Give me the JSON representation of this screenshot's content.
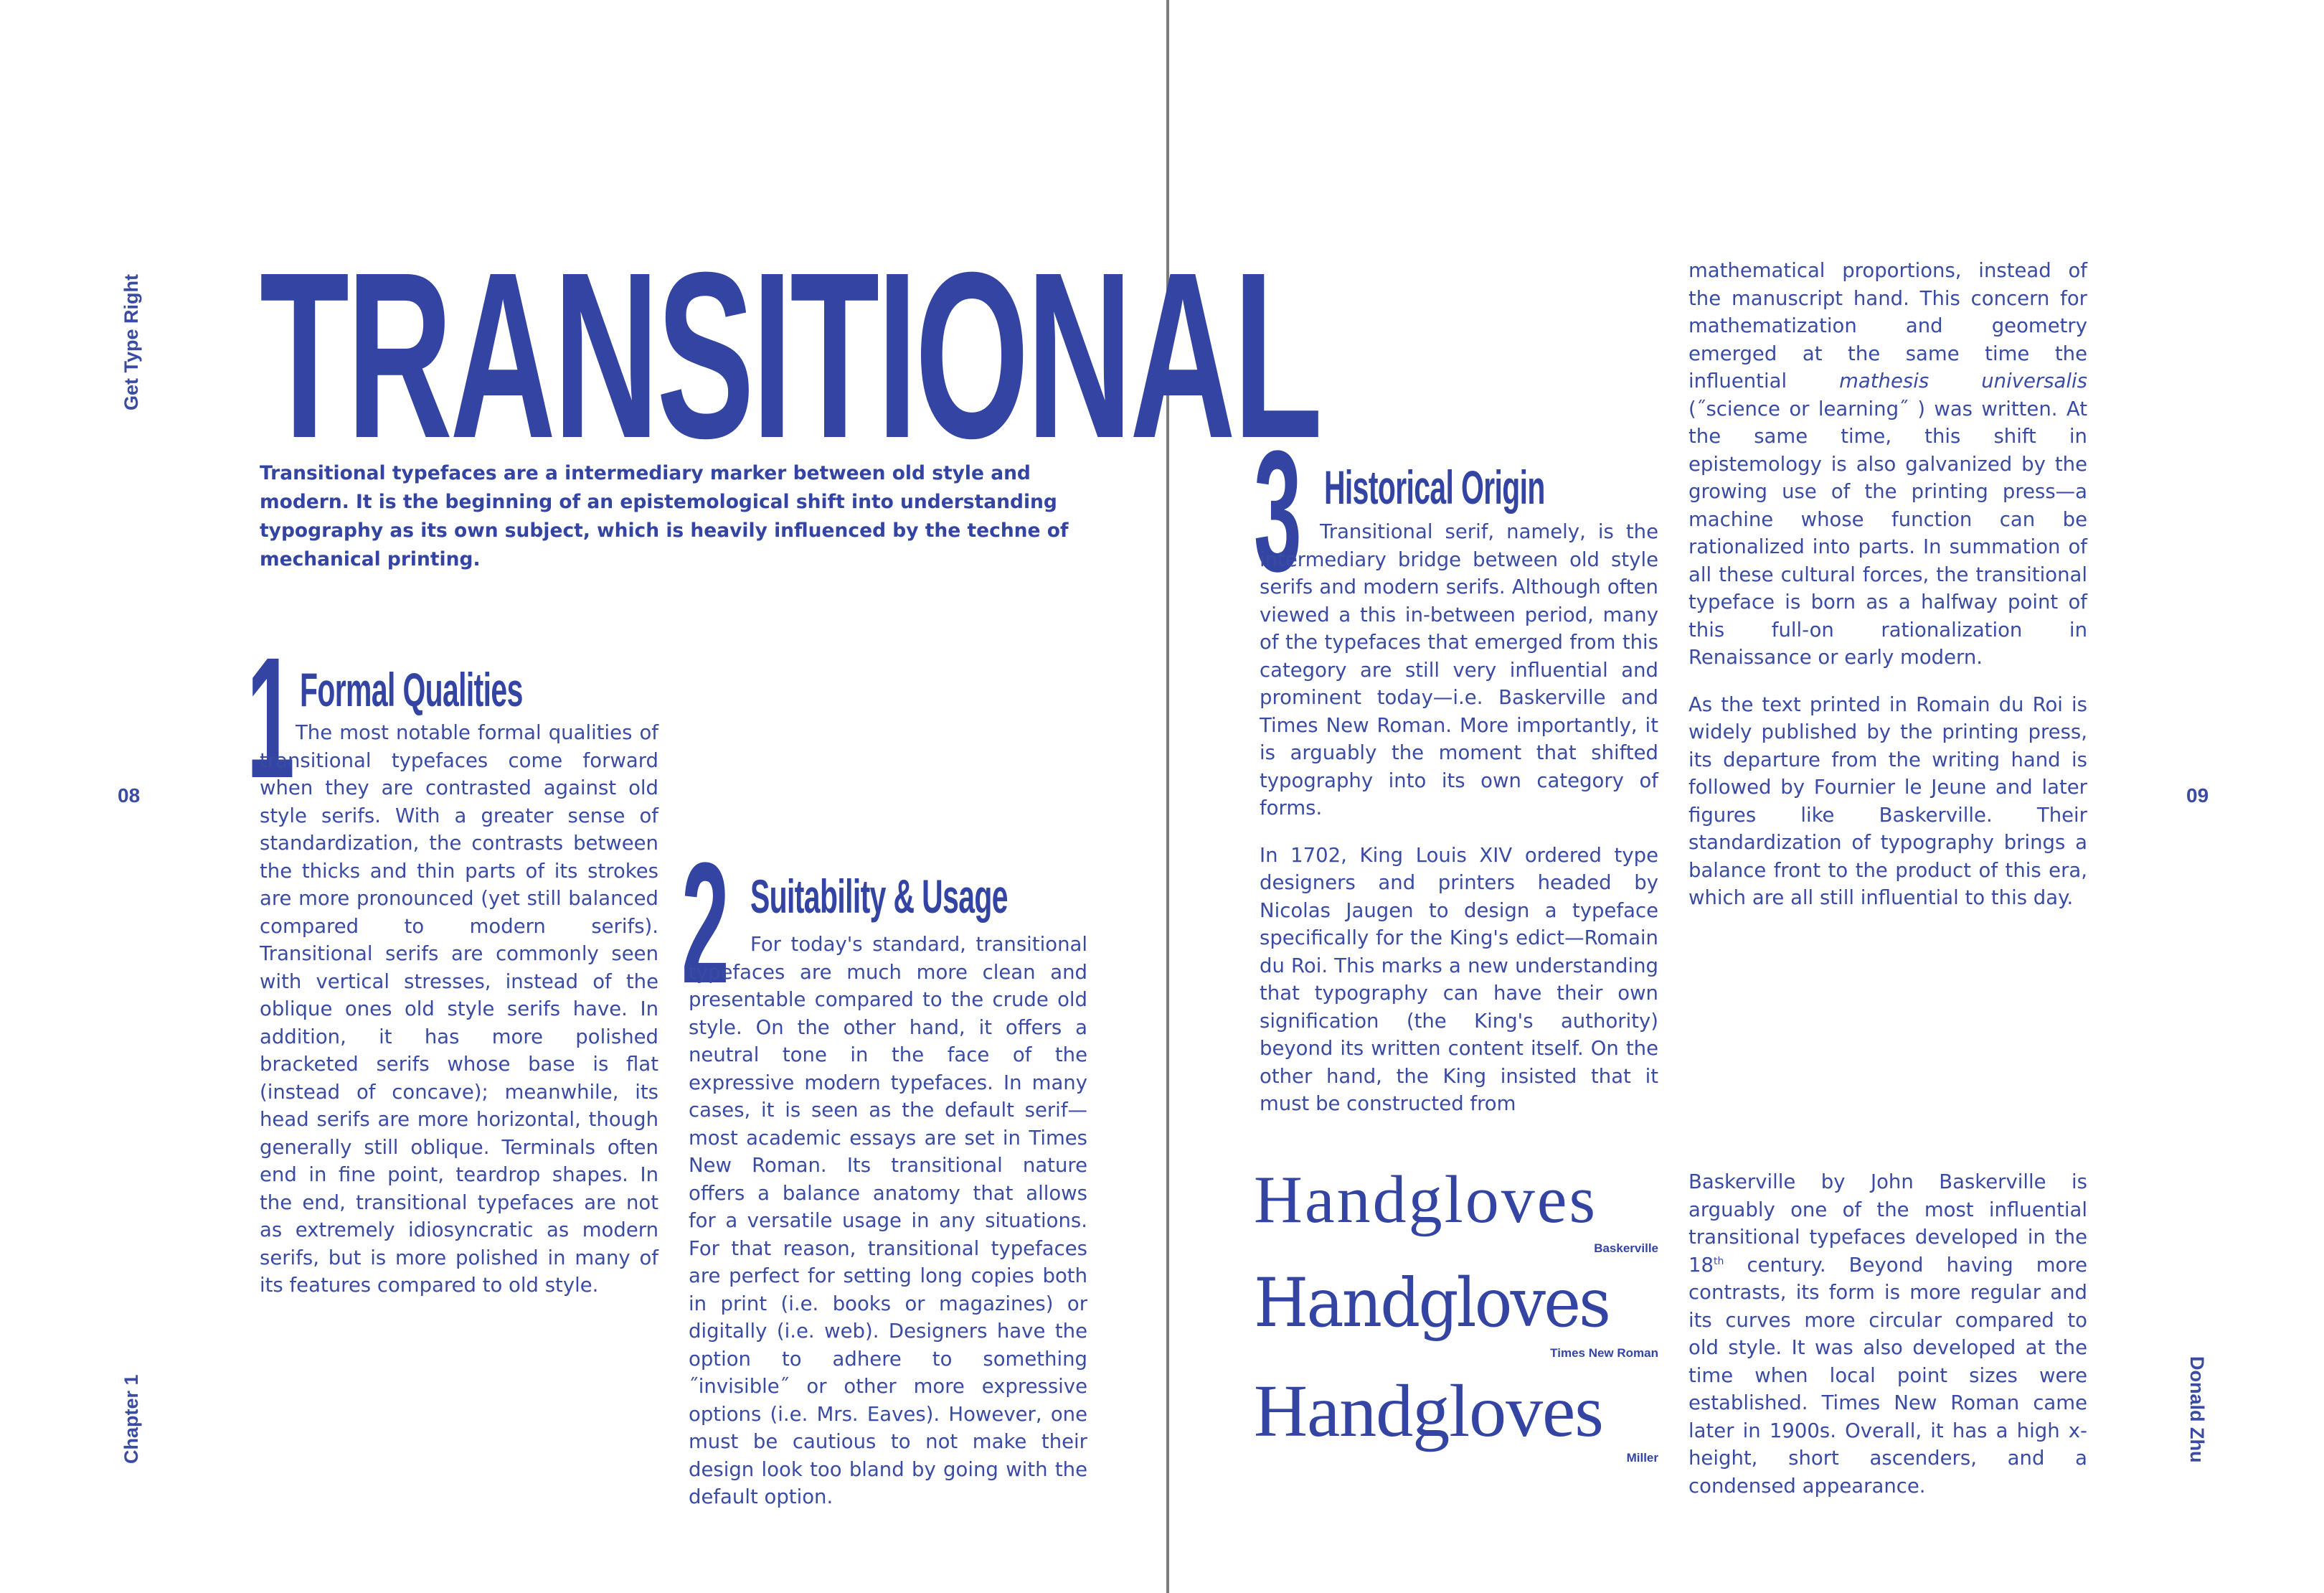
{
  "running_head_left": "Get Type Right",
  "chapter_label": "Chapter 1",
  "author": "Donald Zhu",
  "page_left": "08",
  "page_right": "09",
  "title": "TRANSITIONAL",
  "intro": "Transitional typefaces are a intermediary marker between old style and modern. It is the beginning of an epistemological shift into understanding typography as its own subject, which is heavily influenced by the techne of mechanical printing.",
  "sections": [
    {
      "number": "1",
      "heading": "Formal Qualities",
      "text": "The most notable formal qualities of transitional typefaces come forward when they are contrasted against old style serifs. With a greater sense of standardization, the contrasts between the thicks and thin parts of its strokes are more pronounced (yet still balanced compared to modern serifs). Transitional serifs are commonly seen with vertical stresses, instead of the oblique ones old style serifs have. In addition, it has more polished bracketed serifs whose base is flat (instead of concave); meanwhile, its head serifs are more horizontal, though generally still oblique. Terminals often end in fine point, teardrop shapes. In the end, transitional typefaces are not as extremely idiosyncratic as modern serifs, but is more polished in many of its features compared to old style."
    },
    {
      "number": "2",
      "heading": "Suitability & Usage",
      "text": "For today's standard, transitional typefaces are much more clean and presentable compared to the crude old style. On the other hand, it offers a neutral tone in the face of the expressive modern typefaces. In many cases, it is seen as the default serif—most academic essays are set in Times New Roman. Its transitional nature offers a balance anatomy that allows for a versatile usage in any situations. For that reason, transitional typefaces are perfect for setting long copies both in print (i.e. books or magazines) or digitally (i.e. web). Designers have the option to adhere to something ˝invisible˝ or other more expressive options (i.e. Mrs. Eaves). However, one must be cautious to not make their design look too bland by going with the default option."
    },
    {
      "number": "3",
      "heading": "Historical Origin",
      "text_p1": "Transitional serif, namely, is the intermediary bridge between old style serifs and modern serifs. Although often viewed a this in-between period, many of the typefaces that emerged from this category are still very influential and prominent today—i.e. Baskerville and Times New Roman. More importantly, it is arguably the moment that shifted typography into its own category of forms.",
      "text_p2": "In 1702, King Louis XIV ordered type designers and printers headed by Nicolas Jaugen to design a typeface specifically for the King's edict—Romain du Roi. This marks a new understanding that typography can have their own signification (the King's authority) beyond its written content itself. On the other hand, the King insisted that it must be constructed from"
    }
  ],
  "col4": {
    "p1_before": "mathematical proportions, instead of the manuscript hand. This concern for mathematization and geometry emerged at the same time the influential ",
    "p1_italic": "mathesis universalis",
    "p1_after": " (˝science or learning˝ ) was written. At the same time, this shift in epistemology is also galvanized by the growing use of the printing press—a machine whose function can be rationalized into parts. In summation of all these cultural forces, the transitional typeface is born as a halfway point of this full-on rationalization in Renaissance or early modern.",
    "p2": "As the text printed in Romain du Roi is widely published by the printing press, its departure from the writing hand is followed by Fournier le Jeune and later figures like Baskerville. Their standardization of typography brings a balance front to the product of this era, which are all still influential to this day."
  },
  "specimens": [
    {
      "word": "Handgloves",
      "label": "Baskerville"
    },
    {
      "word": "Handgloves",
      "label": "Times New Roman"
    },
    {
      "word": "Handgloves",
      "label": "Miller"
    }
  ],
  "baskerville_note": {
    "before": "Baskerville by John Baskerville is arguably one of the most influential transitional typefaces developed in the 18",
    "sup": "th",
    "after": " century. Beyond having more contrasts, its form is more regular and its curves more circular compared to old style. It was also developed at the time when local point sizes were established. Times New Roman came later in 1900s. Overall, it has a high x-height, short ascenders, and a condensed appearance."
  },
  "colors": {
    "ink": "#3344a3",
    "spine": "#7a7a7a"
  }
}
